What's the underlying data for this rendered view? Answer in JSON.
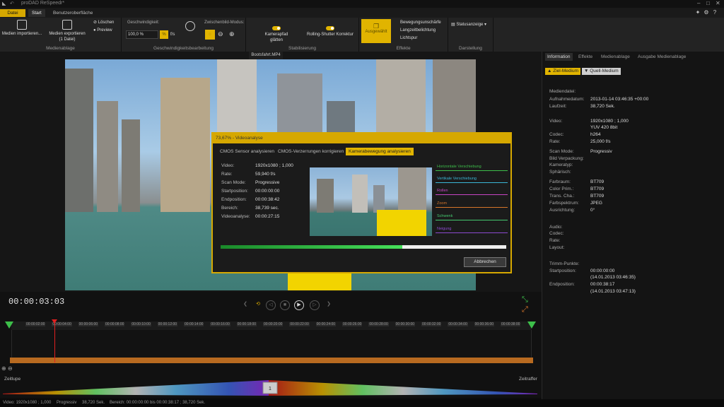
{
  "app": {
    "title": "proDAD ReSpeedr*"
  },
  "menu": {
    "file": "Datei",
    "start": "Start",
    "ui": "Benutzeroberfläche"
  },
  "ribbon": {
    "media_import": "Medien importieren...",
    "media_export": "Medien exportieren",
    "media_export_sub": "(1 Datei)",
    "delete": "Löschen",
    "preview": "Preview",
    "group_media": "Medienablage",
    "speed_label": "Geschwindigkeit:",
    "speed_value": "100,0 %",
    "speed_unit": "f/s",
    "interframe_label": "Zwischenbild-Modus:",
    "group_speed": "Geschwindigkeitsbearbeitung",
    "camera_smooth": "Kamerapfad glätten",
    "rolling_shutter": "Rolling-Shutter Korrektur",
    "group_stab": "Stabilisierung",
    "effects_btn": "Ausgewählt",
    "motion_blur": "Bewegungsunschärfe",
    "long_exposure": "Langzeitbelichtung",
    "light_trail": "Lichtspur",
    "group_effects": "Effekte",
    "status_display": "Statusanzeige",
    "group_display": "Darstellung"
  },
  "video": {
    "filename": "Bootsfahrt.MP4"
  },
  "dialog": {
    "title": "73,67% - Videoanalyse",
    "tabs": [
      "CMOS Sensor analysieren",
      "CMOS-Verzerrungen korrigieren",
      "Kamerabewegung analysieren"
    ],
    "info": [
      {
        "label": "Video:",
        "value": "1920x1080 ; 1,000"
      },
      {
        "label": "Rate:",
        "value": "59,940 f/s"
      },
      {
        "label": "Scan Mode:",
        "value": "Progressive"
      },
      {
        "label": "Startposition:",
        "value": "00:00:00:00"
      },
      {
        "label": "Endposition:",
        "value": "00:00:38:42"
      },
      {
        "label": "Bereich:",
        "value": "38,739 sec."
      },
      {
        "label": "Videoanalyse:",
        "value": "00:00:27:15"
      }
    ],
    "graphs": [
      "Horizontale Verschiebung",
      "Vertikale Verschiebung",
      "Rollen",
      "Zoom",
      "Schwenk",
      "Neigung"
    ],
    "progress": 0.6367,
    "cancel": "Abbrechen"
  },
  "right_panel": {
    "tabs": [
      "Information",
      "Effekte",
      "Medienablage",
      "Ausgabe Medienablage"
    ],
    "target": "Ziel-Medium",
    "source": "Quell-Medium",
    "section_media": "Mediendatei:",
    "rows": [
      {
        "label": "Aufnahmedatum:",
        "value": "2013-01-14 03:46:35 +00:00"
      },
      {
        "label": "Laufzeit:",
        "value": "38,720 Sek."
      },
      {
        "label": "Video:",
        "value": "1920x1080 ; 1,000"
      },
      {
        "label": "",
        "value": "YUV 420 8bit"
      },
      {
        "label": "Codec:",
        "value": "h264"
      },
      {
        "label": "Rate:",
        "value": "25,000 f/s"
      },
      {
        "label": "Scan Mode:",
        "value": "Progressiv"
      },
      {
        "label": "Bild Verpackung:",
        "value": ""
      },
      {
        "label": "Kameratyp:",
        "value": ""
      },
      {
        "label": "Sphärisch:",
        "value": ""
      },
      {
        "label": "Farbraum:",
        "value": "BT709"
      },
      {
        "label": "Color Prim.:",
        "value": "BT709"
      },
      {
        "label": "Trans. Cha.:",
        "value": "BT709"
      },
      {
        "label": "Farbspektrum:",
        "value": "JPEG"
      },
      {
        "label": "Ausrichtung:",
        "value": "0°"
      },
      {
        "label": "Audio:",
        "value": ""
      },
      {
        "label": "Codec:",
        "value": ""
      },
      {
        "label": "Rate:",
        "value": ""
      },
      {
        "label": "Layout:",
        "value": ""
      },
      {
        "label": "Trimm-Punkte:",
        "value": ""
      },
      {
        "label": "Startposition:",
        "value": "00:00:00:00"
      },
      {
        "label": "",
        "value": "(14.01.2013 03:46:35)"
      },
      {
        "label": "Endposition:",
        "value": "00:00:38:17"
      },
      {
        "label": "",
        "value": "(14.01.2013 03:47:13)"
      }
    ]
  },
  "timeline": {
    "timecode": "00:00:03:03",
    "ticks": [
      "00:00:02:00",
      "00:00:04:00",
      "00:00:06:00",
      "00:00:08:00",
      "00:00:10:00",
      "00:00:12:00",
      "00:00:14:00",
      "00:00:16:00",
      "00:00:18:00",
      "00:00:20:00",
      "00:00:22:00",
      "00:00:24:00",
      "00:00:26:00",
      "00:00:28:00",
      "00:00:30:00",
      "00:00:32:00",
      "00:00:34:00",
      "00:00:36:00",
      "00:00:38:00"
    ],
    "slowmo": "Zeitlupe",
    "timelapse": "Zeitraffer",
    "speed_center": "1"
  },
  "status": {
    "video": "Video: 1920x1080 ; 1,000",
    "scan": "Progressiv",
    "duration": "38,720 Sek.",
    "range": "Bereich: 00:00:00:00 bis 00:00:38:17 ; 38,720 Sek."
  }
}
